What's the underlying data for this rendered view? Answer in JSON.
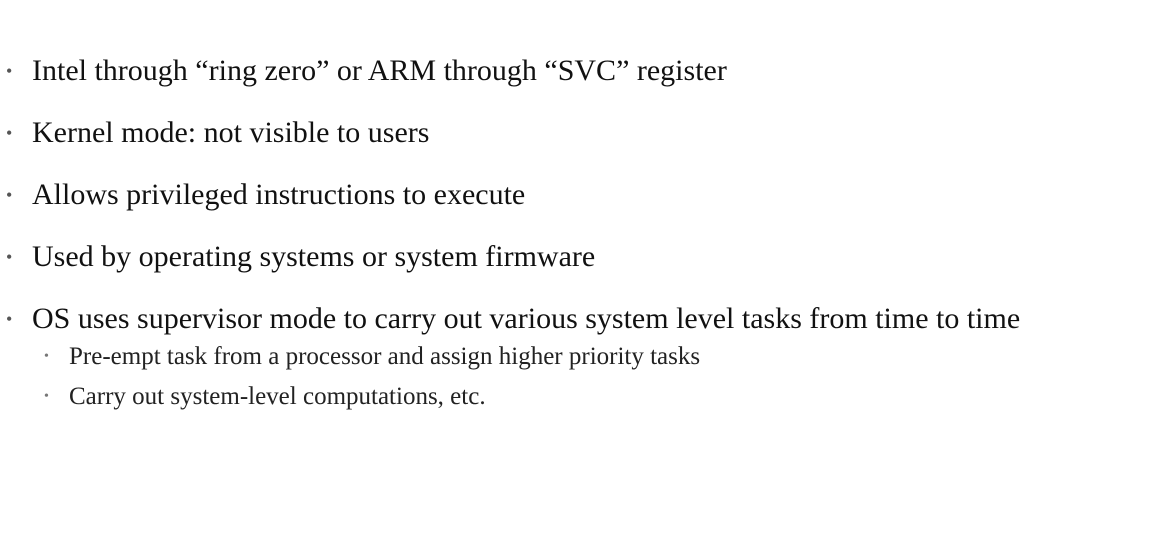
{
  "slide": {
    "bullets": [
      {
        "text": "Intel through “ring zero” or ARM through “SVC” register"
      },
      {
        "text": "Kernel mode: not visible to users"
      },
      {
        "text": "Allows privileged instructions to execute"
      },
      {
        "text": "Used by operating systems or system firmware"
      },
      {
        "text": "OS uses supervisor mode to carry out various system level tasks from time to time",
        "sub": [
          {
            "text": "Pre-empt task from a processor and assign higher priority tasks"
          },
          {
            "text": "Carry out system-level computations, etc."
          }
        ]
      }
    ]
  }
}
